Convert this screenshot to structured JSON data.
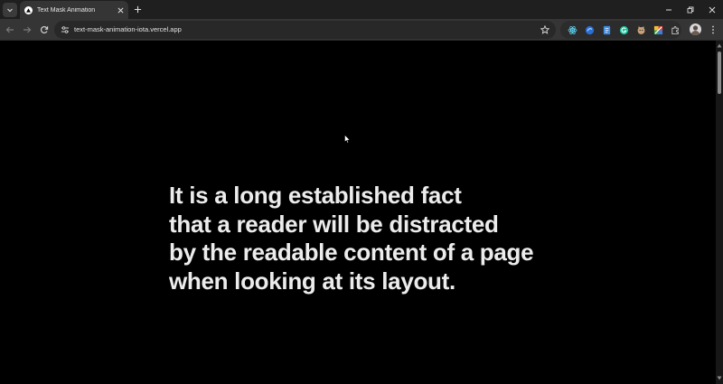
{
  "browser": {
    "tab": {
      "title": "Text Mask Animation"
    },
    "omnibox": {
      "url": "text-mask-animation-iota.vercel.app"
    },
    "extensions": [
      "react-devtools-icon",
      "extension-blue-icon",
      "extension-doc-icon",
      "grammarly-icon",
      "extension-cat-icon",
      "color-picker-icon",
      "puzzle-icon"
    ]
  },
  "page": {
    "headline_lines": [
      "It is a long established fact",
      "that a reader will be distracted",
      "by the readable content of a page",
      "when looking at its layout."
    ]
  },
  "colors": {
    "page_background": "#000000",
    "headline_text": "#ececec",
    "chrome_dark": "#1f1f1f",
    "chrome_toolbar": "#353535"
  }
}
